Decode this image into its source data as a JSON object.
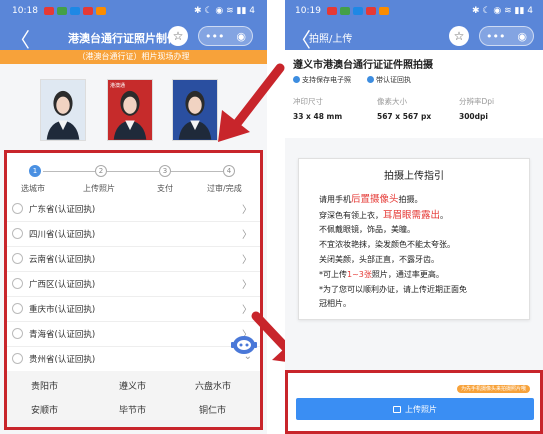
{
  "left": {
    "status_time": "10:18",
    "status_right": "✱ ☾ ◉ ≋ ▮▮ 4",
    "nav": {
      "back": "〈",
      "title": "港澳台通行证照片制作",
      "star": "☆",
      "more": "•••",
      "record": "◉"
    },
    "banner": "（港澳台通行证）相片现场办理",
    "photos": [
      {
        "tag": "",
        "bg": "#dfe8f2"
      },
      {
        "tag": "港澳通",
        "bg": "#c62b2b"
      },
      {
        "tag": "",
        "bg": "#2a4fa0"
      }
    ],
    "steps": [
      {
        "num": "1",
        "label": "选城市",
        "active": true
      },
      {
        "num": "2",
        "label": "上传照片",
        "active": false
      },
      {
        "num": "3",
        "label": "支付",
        "active": false
      },
      {
        "num": "4",
        "label": "过审/完成",
        "active": false
      }
    ],
    "provinces": [
      "广东省(认证回执)",
      "四川省(认证回执)",
      "云南省(认证回执)",
      "广西区(认证回执)",
      "重庆市(认证回执)",
      "青海省(认证回执)",
      "贵州省(认证回执)"
    ],
    "province_arrow": "〉",
    "cities": [
      "贵阳市",
      "遵义市",
      "六盘水市",
      "安顺市",
      "毕节市",
      "铜仁市"
    ]
  },
  "right": {
    "status_time": "10:19",
    "nav": {
      "back": "〈",
      "title": "拍照/上传",
      "star": "☆",
      "more": "•••",
      "record": "◉"
    },
    "heading": "遵义市港澳台通行证证件照拍摄",
    "badges": [
      "支持保存电子照",
      "带认证回执"
    ],
    "spec_labels": [
      "冲印尺寸",
      "像素大小",
      "分辨率Dpi"
    ],
    "spec_values": [
      "33 x 48 mm",
      "567 x 567 px",
      "300dpi"
    ],
    "guide": {
      "title": "拍摄上传指引",
      "l1a": "请用手机",
      "l1b": "后置摄像头",
      "l1c": "拍摄。",
      "l2a": "穿深色有领上衣，",
      "l2b": "耳眉眼需露出",
      "l2c": "。",
      "l3": "不佩戴眼镜，饰品，美瞳。",
      "l4": "不宜浓妆艳抹，染发颜色不能太夸张。",
      "l5": "关闭美颜，头部正直，不露牙齿。",
      "l6a": "*可上传",
      "l6b": "1~3张",
      "l6c": "照片，通过率更高。",
      "l7": "*为了您可以顺利办证，请上传近期正面免",
      "l8": "冠相片。"
    },
    "footer_tip": "为先手机摄像头来拍摄照片哦",
    "upload_label": "上传照片"
  },
  "colors": {
    "nav_blue": "#5a86d8",
    "orange": "#f7a23a",
    "red_frame": "#c8252b",
    "button_blue": "#3a8ef3",
    "red_text": "#e53935"
  }
}
